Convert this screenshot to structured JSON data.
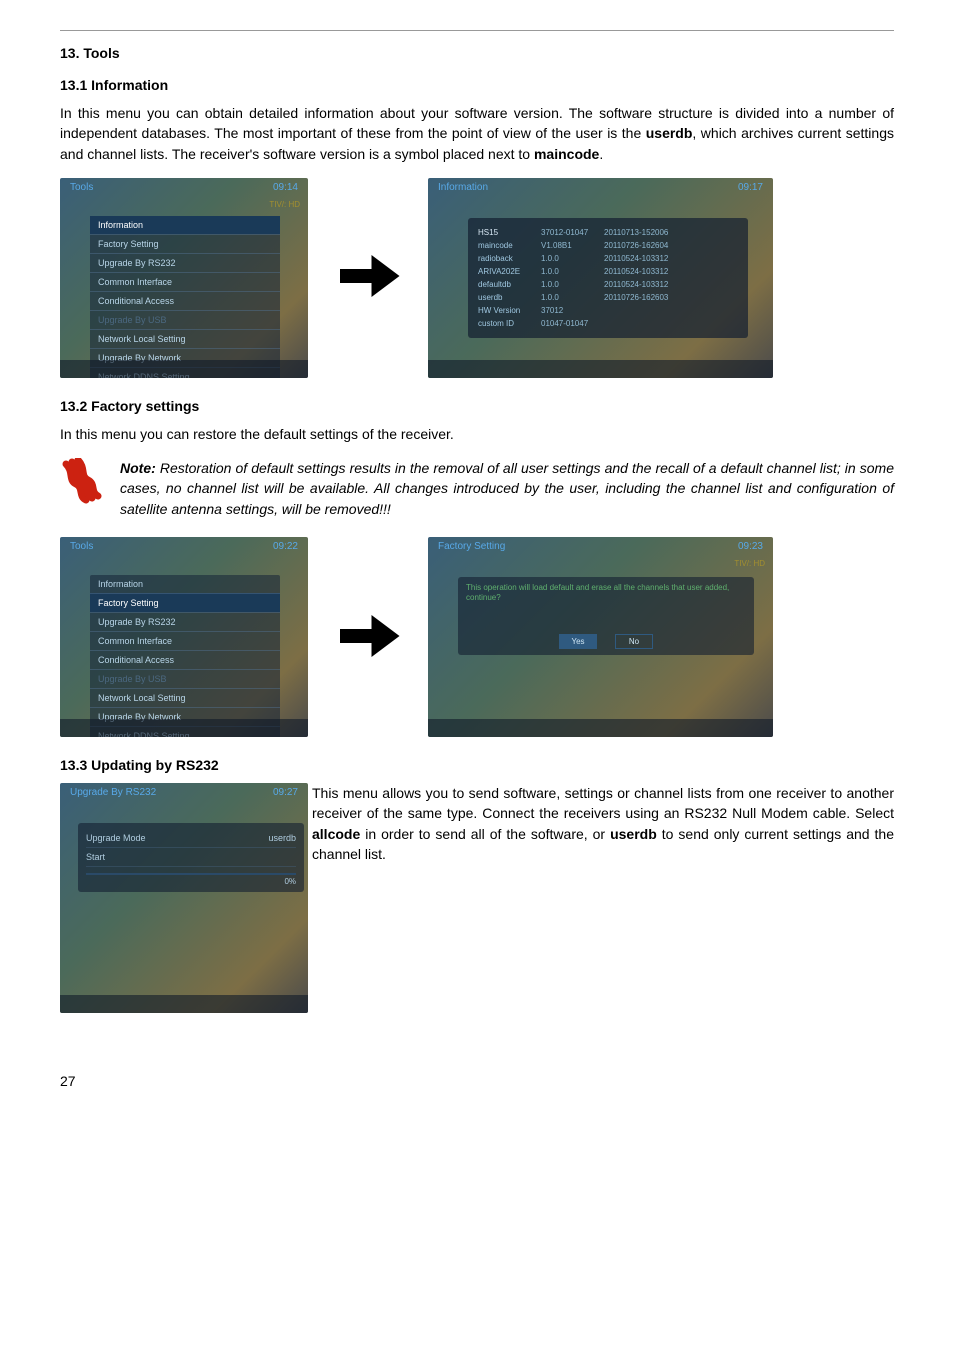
{
  "headings": {
    "h_13": "13. Tools",
    "h_13_1": "13.1 Information",
    "h_13_2": "13.2 Factory settings",
    "h_13_3": "13.3 Updating by RS232"
  },
  "paragraphs": {
    "p_13_1_a": "In this menu you can obtain detailed information about your software version. The software structure is divided into a number of independent databases. The most important of these from the point of view of the user is the ",
    "p_13_1_b": ",  which archives current settings and channel lists. The receiver's software version is a symbol placed next to ",
    "p_13_1_c": ".",
    "bold_userdb": "userdb",
    "bold_maincode": "maincode",
    "p_13_2": "In this menu you can restore the default settings of the receiver.",
    "note_label": "Note:",
    "note_text": " Restoration of default settings results in the removal of all user settings and the recall of a default channel list; in some cases,  no channel list will be available. All changes introduced by the user,  including the channel list and configuration of satellite antenna settings,  will be removed!!!",
    "p_13_3_a": "This menu allows you to send software,  settings or channel lists from one receiver to another receiver of the same type. Connect the receivers using an RS232 Null Modem cable. Select ",
    "p_13_3_b": " in order to send all of the software,  or ",
    "p_13_3_c": " to send only current settings and the channel list.",
    "bold_allcode": "allcode"
  },
  "page_number": "27",
  "screenshot_tools_menu": {
    "title": "Tools",
    "clock": "09:14",
    "badge": "TIV/: HD",
    "items": [
      {
        "label": "Information",
        "style": "highlight"
      },
      {
        "label": "Factory Setting",
        "style": ""
      },
      {
        "label": "Upgrade By RS232",
        "style": ""
      },
      {
        "label": "Common Interface",
        "style": ""
      },
      {
        "label": "Conditional Access",
        "style": ""
      },
      {
        "label": "Upgrade By USB",
        "style": "dim"
      },
      {
        "label": "Network Local Setting",
        "style": ""
      },
      {
        "label": "Upgrade By Network",
        "style": ""
      },
      {
        "label": "Network DDNS Setting",
        "style": ""
      }
    ]
  },
  "screenshot_info": {
    "title": "Information",
    "clock": "09:17",
    "rows": [
      {
        "k": "HS15",
        "v1": "37012-01047",
        "v2": "20110713-152006"
      },
      {
        "k": "maincode",
        "v1": "V1.08B1",
        "v2": "20110726-162604"
      },
      {
        "k": "radioback",
        "v1": "1.0.0",
        "v2": "20110524-103312"
      },
      {
        "k": "ARIVA202E",
        "v1": "1.0.0",
        "v2": "20110524-103312"
      },
      {
        "k": "defaultdb",
        "v1": "1.0.0",
        "v2": "20110524-103312"
      },
      {
        "k": "userdb",
        "v1": "1.0.0",
        "v2": "20110726-162603"
      },
      {
        "k": "HW Version",
        "v1": "37012",
        "v2": ""
      },
      {
        "k": "custom ID",
        "v1": "01047-01047",
        "v2": ""
      }
    ]
  },
  "screenshot_tools_menu_2": {
    "title": "Tools",
    "clock": "09:22",
    "items": [
      {
        "label": "Information",
        "style": ""
      },
      {
        "label": "Factory Setting",
        "style": "highlight"
      },
      {
        "label": "Upgrade By RS232",
        "style": ""
      },
      {
        "label": "Common Interface",
        "style": ""
      },
      {
        "label": "Conditional Access",
        "style": ""
      },
      {
        "label": "Upgrade By USB",
        "style": "dim"
      },
      {
        "label": "Network Local Setting",
        "style": ""
      },
      {
        "label": "Upgrade By Network",
        "style": ""
      },
      {
        "label": "Network DDNS Setting",
        "style": ""
      }
    ]
  },
  "screenshot_factory_confirm": {
    "title": "Factory Setting",
    "clock": "09:23",
    "badge": "TIV/: HD",
    "message": "This operation will load default and erase all the channels that user added, continue?",
    "yes": "Yes",
    "no": "No"
  },
  "screenshot_upgrade_rs232": {
    "title": "Upgrade By RS232",
    "clock": "09:27",
    "rows": [
      {
        "l": "Upgrade Mode",
        "r": "userdb"
      },
      {
        "l": "Start",
        "r": ""
      }
    ],
    "percent": "0%"
  }
}
